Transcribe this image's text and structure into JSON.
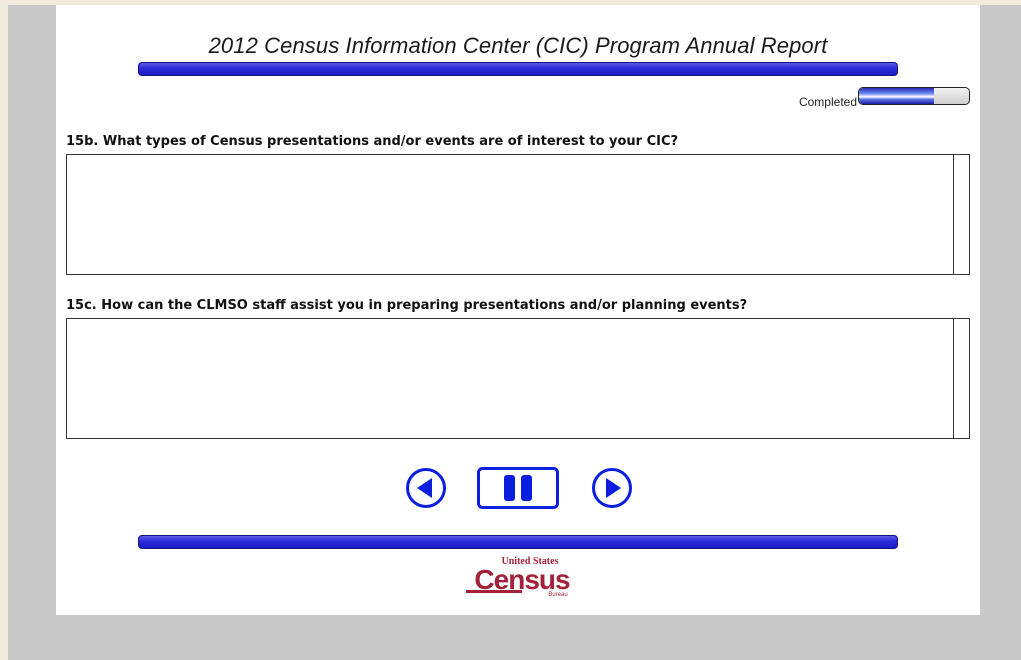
{
  "header": {
    "title": "2012 Census Information Center (CIC) Program Annual Report"
  },
  "progress": {
    "label": "Completed",
    "fraction": 0.68
  },
  "questions": [
    {
      "label": "15b. What types of Census presentations and/or events are of interest to your CIC?",
      "value": ""
    },
    {
      "label": "15c. How can the CLMSO staff assist you in preparing presentations and/or planning events?",
      "value": ""
    }
  ],
  "navigation": {
    "prev_icon": "circle-left-arrow-icon",
    "pause_icon": "pause-icon",
    "next_icon": "circle-right-arrow-icon"
  },
  "footer": {
    "logo_top": "United States",
    "logo_main": "Census",
    "logo_bottom": "Bureau"
  },
  "colors": {
    "accent": "#1c1cc4",
    "nav_blue": "#0a1ee0",
    "logo_red": "#a3223a",
    "background": "#c8c8c8",
    "panel": "#ffffff"
  }
}
